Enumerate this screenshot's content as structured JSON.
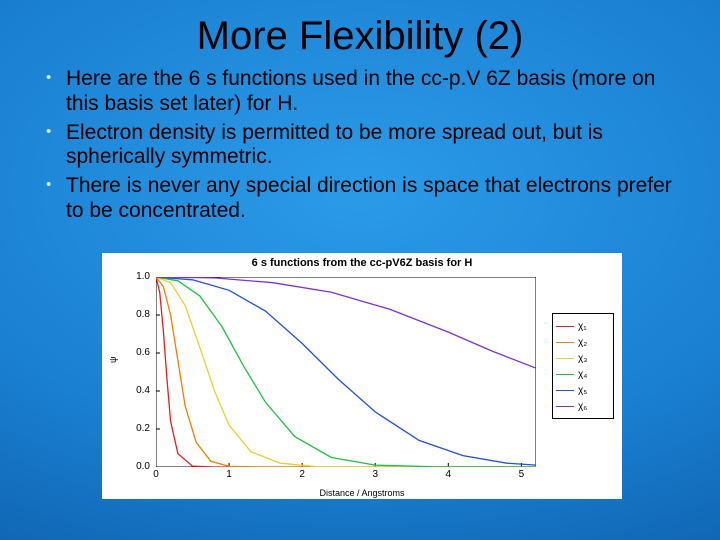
{
  "title": "More Flexibility (2)",
  "bullets": [
    "Here are the 6 s functions used in the\ncc-p.V 6Z basis (more on this basis set later) for H.",
    "Electron density is permitted to be more spread out, but is spherically symmetric.",
    "There is never any special direction is space that electrons prefer to be concentrated."
  ],
  "chart_data": {
    "type": "line",
    "title": "6 s functions from the cc-pV6Z basis for H",
    "xlabel": "Distance / Angstroms",
    "ylabel": "ψ",
    "xlim": [
      0,
      5.2
    ],
    "ylim": [
      0.0,
      1.0
    ],
    "xticks": [
      0,
      1,
      2,
      3,
      4,
      5
    ],
    "yticks": [
      0.0,
      0.2,
      0.4,
      0.6,
      0.8,
      1.0
    ],
    "series": [
      {
        "name": "χ₁",
        "color": "#e02020",
        "x": [
          0,
          0.05,
          0.1,
          0.15,
          0.2,
          0.3,
          0.5,
          0.8,
          1.2,
          2.0,
          5.2
        ],
        "y": [
          1.0,
          0.92,
          0.72,
          0.46,
          0.24,
          0.07,
          0.005,
          0,
          0,
          0,
          0
        ]
      },
      {
        "name": "χ₂",
        "color": "#f08000",
        "x": [
          0,
          0.1,
          0.2,
          0.3,
          0.4,
          0.55,
          0.75,
          1.0,
          1.4,
          2.0,
          5.2
        ],
        "y": [
          1.0,
          0.95,
          0.8,
          0.56,
          0.32,
          0.13,
          0.03,
          0.003,
          0,
          0,
          0
        ]
      },
      {
        "name": "χ₃",
        "color": "#e8d030",
        "x": [
          0,
          0.2,
          0.4,
          0.6,
          0.8,
          1.0,
          1.3,
          1.7,
          2.2,
          3.0,
          5.2
        ],
        "y": [
          1.0,
          0.97,
          0.85,
          0.63,
          0.4,
          0.22,
          0.08,
          0.02,
          0.002,
          0,
          0
        ]
      },
      {
        "name": "χ₄",
        "color": "#20c040",
        "x": [
          0,
          0.3,
          0.6,
          0.9,
          1.2,
          1.5,
          1.9,
          2.4,
          3.0,
          3.8,
          5.2
        ],
        "y": [
          1.0,
          0.98,
          0.9,
          0.74,
          0.53,
          0.34,
          0.16,
          0.05,
          0.01,
          0.001,
          0
        ]
      },
      {
        "name": "χ₅",
        "color": "#2050e0",
        "x": [
          0,
          0.5,
          1.0,
          1.5,
          2.0,
          2.5,
          3.0,
          3.6,
          4.2,
          4.8,
          5.2
        ],
        "y": [
          1.0,
          0.985,
          0.93,
          0.82,
          0.65,
          0.46,
          0.29,
          0.14,
          0.06,
          0.02,
          0.01
        ]
      },
      {
        "name": "χ₆",
        "color": "#8030d0",
        "x": [
          0,
          0.8,
          1.6,
          2.4,
          3.2,
          4.0,
          4.6,
          5.2
        ],
        "y": [
          1.0,
          0.995,
          0.97,
          0.92,
          0.83,
          0.71,
          0.61,
          0.52
        ]
      }
    ]
  }
}
